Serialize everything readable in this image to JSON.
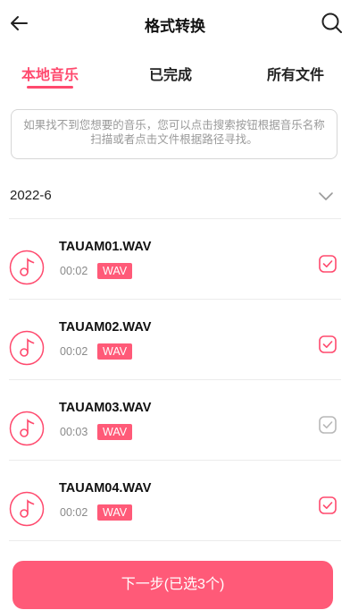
{
  "header": {
    "title": "格式转换",
    "back_icon": "arrow-left-icon",
    "search_icon": "search-icon"
  },
  "tabs": [
    {
      "label": "本地音乐",
      "active": true
    },
    {
      "label": "已完成",
      "active": false
    },
    {
      "label": "所有文件",
      "active": false
    }
  ],
  "notice": "如果找不到您想要的音乐，您可以点击搜索按钮根据音乐名称扫描或者点击文件根据路径寻找。",
  "group": {
    "date": "2022-6",
    "chevron_icon": "chevron-down-icon"
  },
  "files": [
    {
      "name": "TAUAM01.WAV",
      "duration": "00:02",
      "format": "WAV",
      "checked": true
    },
    {
      "name": "TAUAM02.WAV",
      "duration": "00:02",
      "format": "WAV",
      "checked": true
    },
    {
      "name": "TAUAM03.WAV",
      "duration": "00:03",
      "format": "WAV",
      "checked": false
    },
    {
      "name": "TAUAM04.WAV",
      "duration": "00:02",
      "format": "WAV",
      "checked": true
    }
  ],
  "next_button": "下一步(已选3个)",
  "colors": {
    "accent": "#ff4a6e",
    "badge": "#ff5a78",
    "check_unselected": "#b8b8b8"
  }
}
